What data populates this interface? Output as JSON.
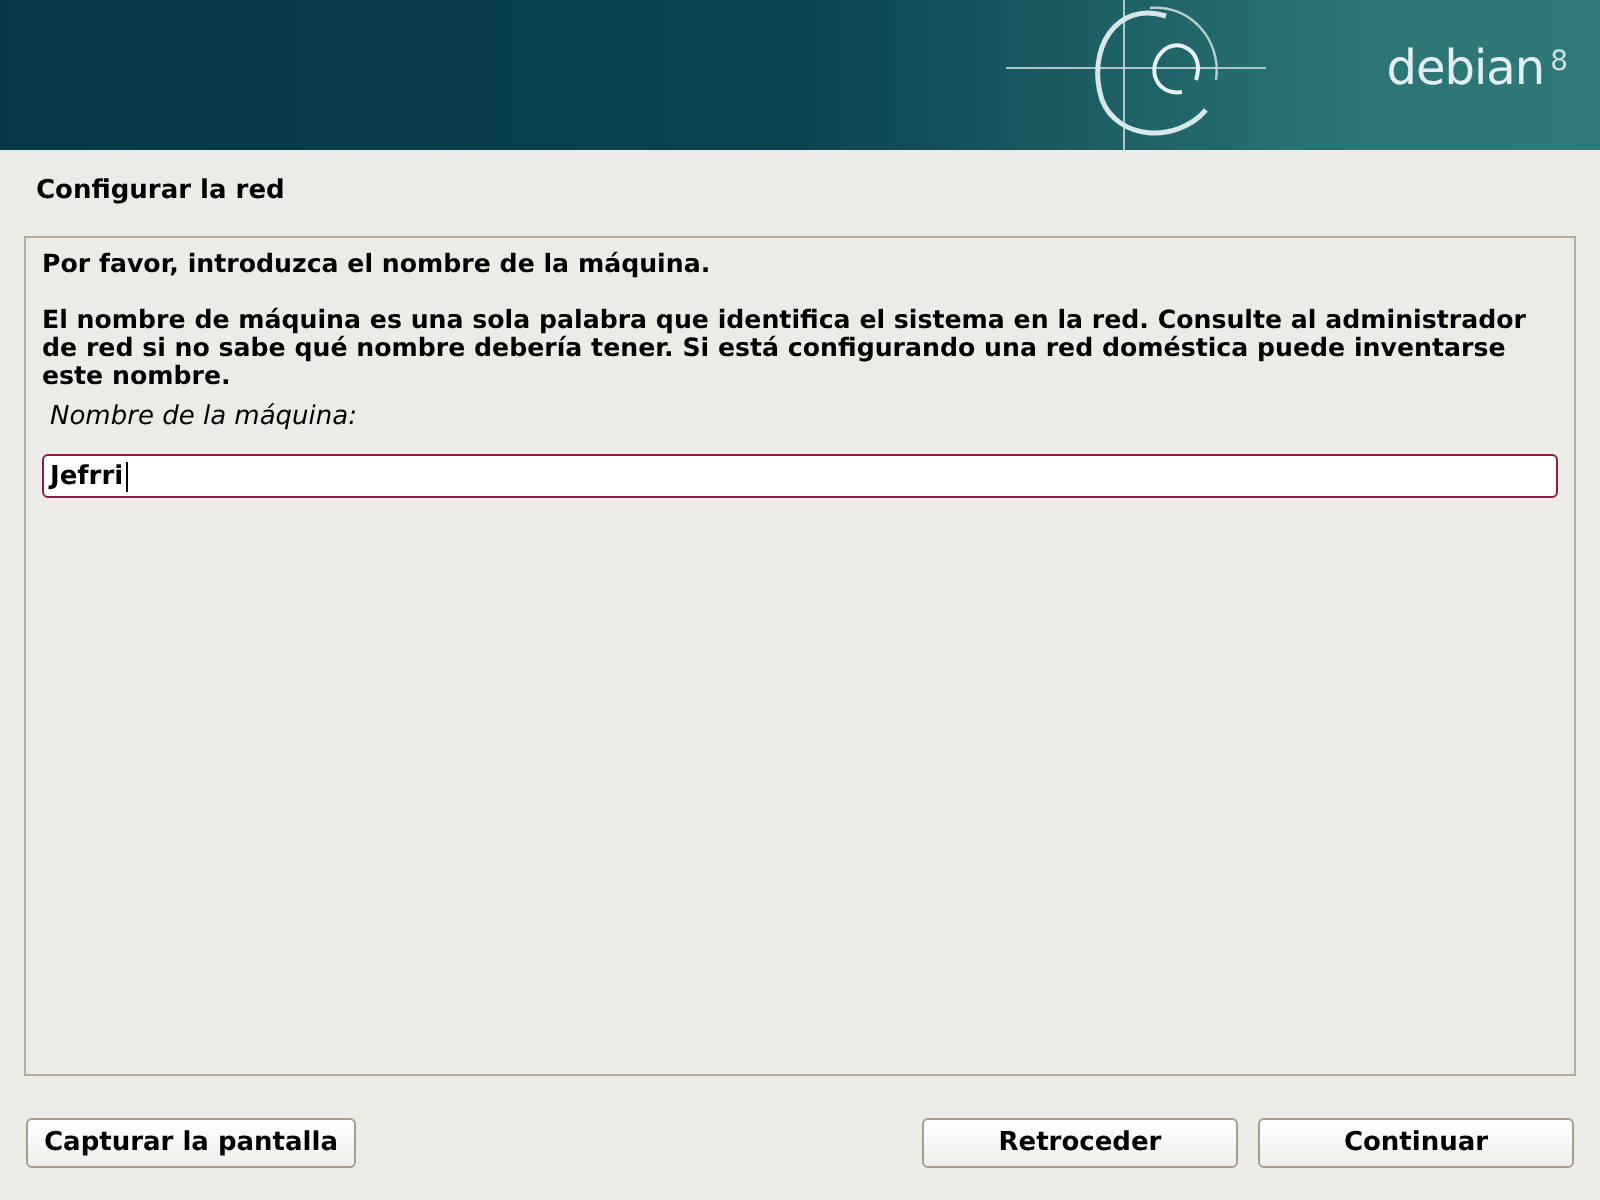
{
  "banner": {
    "logo_text": "debian",
    "version": "8"
  },
  "section_title": "Configurar la red",
  "prompt": "Por favor, introduzca el nombre de la máquina.",
  "description": "El nombre de máquina es una sola palabra que identifica el sistema en la red. Consulte al administrador de red si no sabe qué nombre debería tener. Si está configurando una red doméstica puede inventarse este nombre.",
  "field": {
    "label": "Nombre de la máquina:",
    "value": "Jefrri"
  },
  "buttons": [
    {
      "label": "Capturar la pantalla",
      "kind": "left"
    },
    {
      "label": "Retroceder",
      "kind": "right"
    },
    {
      "label": "Continuar",
      "kind": "right"
    }
  ]
}
